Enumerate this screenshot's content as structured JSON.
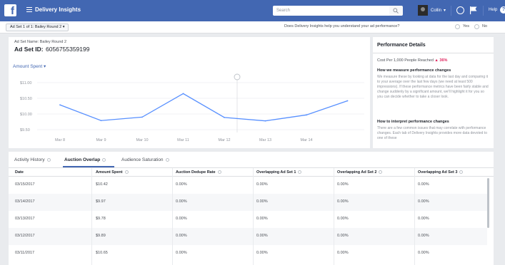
{
  "topbar": {
    "app_title": "Delivery Insights",
    "search_placeholder": "Search",
    "user_name": "Collin",
    "help_label": "Help"
  },
  "subheader": {
    "adset_selector": "Ad Set 1 of 1: Bailey Round 2",
    "question": "Does Delivery Insights help you understand your ad performance?",
    "yes": "Yes",
    "no": "No"
  },
  "summary": {
    "adset_name_label": "Ad Set Name: Bailey Round 2",
    "adset_id_label": "Ad Set ID:",
    "adset_id_value": "6056755359199",
    "metric_dropdown": "Amount Spent"
  },
  "chart_data": {
    "type": "line",
    "categories": [
      "Mar 8",
      "Mar 9",
      "Mar 10",
      "Mar 11",
      "Mar 12",
      "Mar 13",
      "Mar 14",
      "Mar 15"
    ],
    "x_tick_labels": [
      "Mar 8",
      "Mar 9",
      "Mar 10",
      "Mar 11",
      "Mar 12",
      "Mar 13",
      "Mar 14"
    ],
    "values": [
      10.29,
      9.79,
      9.9,
      10.65,
      9.89,
      9.78,
      9.97,
      10.42
    ],
    "yticks": [
      "$11.00",
      "$10.50",
      "$10.00",
      "$9.50"
    ],
    "ytick_values": [
      11.0,
      10.5,
      10.0,
      9.5
    ],
    "ylim": [
      9.5,
      11.0
    ],
    "marker_category": "Mar 12",
    "color": "#5890ff",
    "grid": true
  },
  "performance": {
    "title": "Performance Details",
    "cost_label": "Cost Per 1,000 People Reached",
    "cost_change": "36%",
    "h1": "How we measure performance changes",
    "p1": "We measure these by looking at data for the last day and comparing it to your average over the last few days (we need at least 500 impressions). If these performance metrics have been fairly stable and change suddenly by a significant amount, we'll highlight it for you so you can decide whether to take a closer look.",
    "h2": "How to interpret performance changes",
    "p2": "There are a few common issues that may correlate with performance changes. Each tab of Delivery Insights provides more data devoted to one of these"
  },
  "tabs": [
    {
      "label": "Activity History"
    },
    {
      "label": "Auction Overlap"
    },
    {
      "label": "Audience Saturation"
    }
  ],
  "table": {
    "headers": [
      "Date",
      "Amount Spent",
      "Auction Dedupe Rate",
      "Overlapping Ad Set 1",
      "Overlapping Ad Set 2",
      "Overlapping Ad Set 3"
    ],
    "rows": [
      [
        "03/15/2017",
        "$10.42",
        "0.00%",
        "0.00%",
        "0.00%",
        "0.00%"
      ],
      [
        "03/14/2017",
        "$9.97",
        "0.00%",
        "0.00%",
        "0.00%",
        "0.00%"
      ],
      [
        "03/13/2017",
        "$9.78",
        "0.00%",
        "0.00%",
        "0.00%",
        "0.00%"
      ],
      [
        "03/12/2017",
        "$9.89",
        "0.00%",
        "0.00%",
        "0.00%",
        "0.00%"
      ],
      [
        "03/11/2017",
        "$10.65",
        "0.00%",
        "0.00%",
        "0.00%",
        "0.00%"
      ]
    ]
  }
}
